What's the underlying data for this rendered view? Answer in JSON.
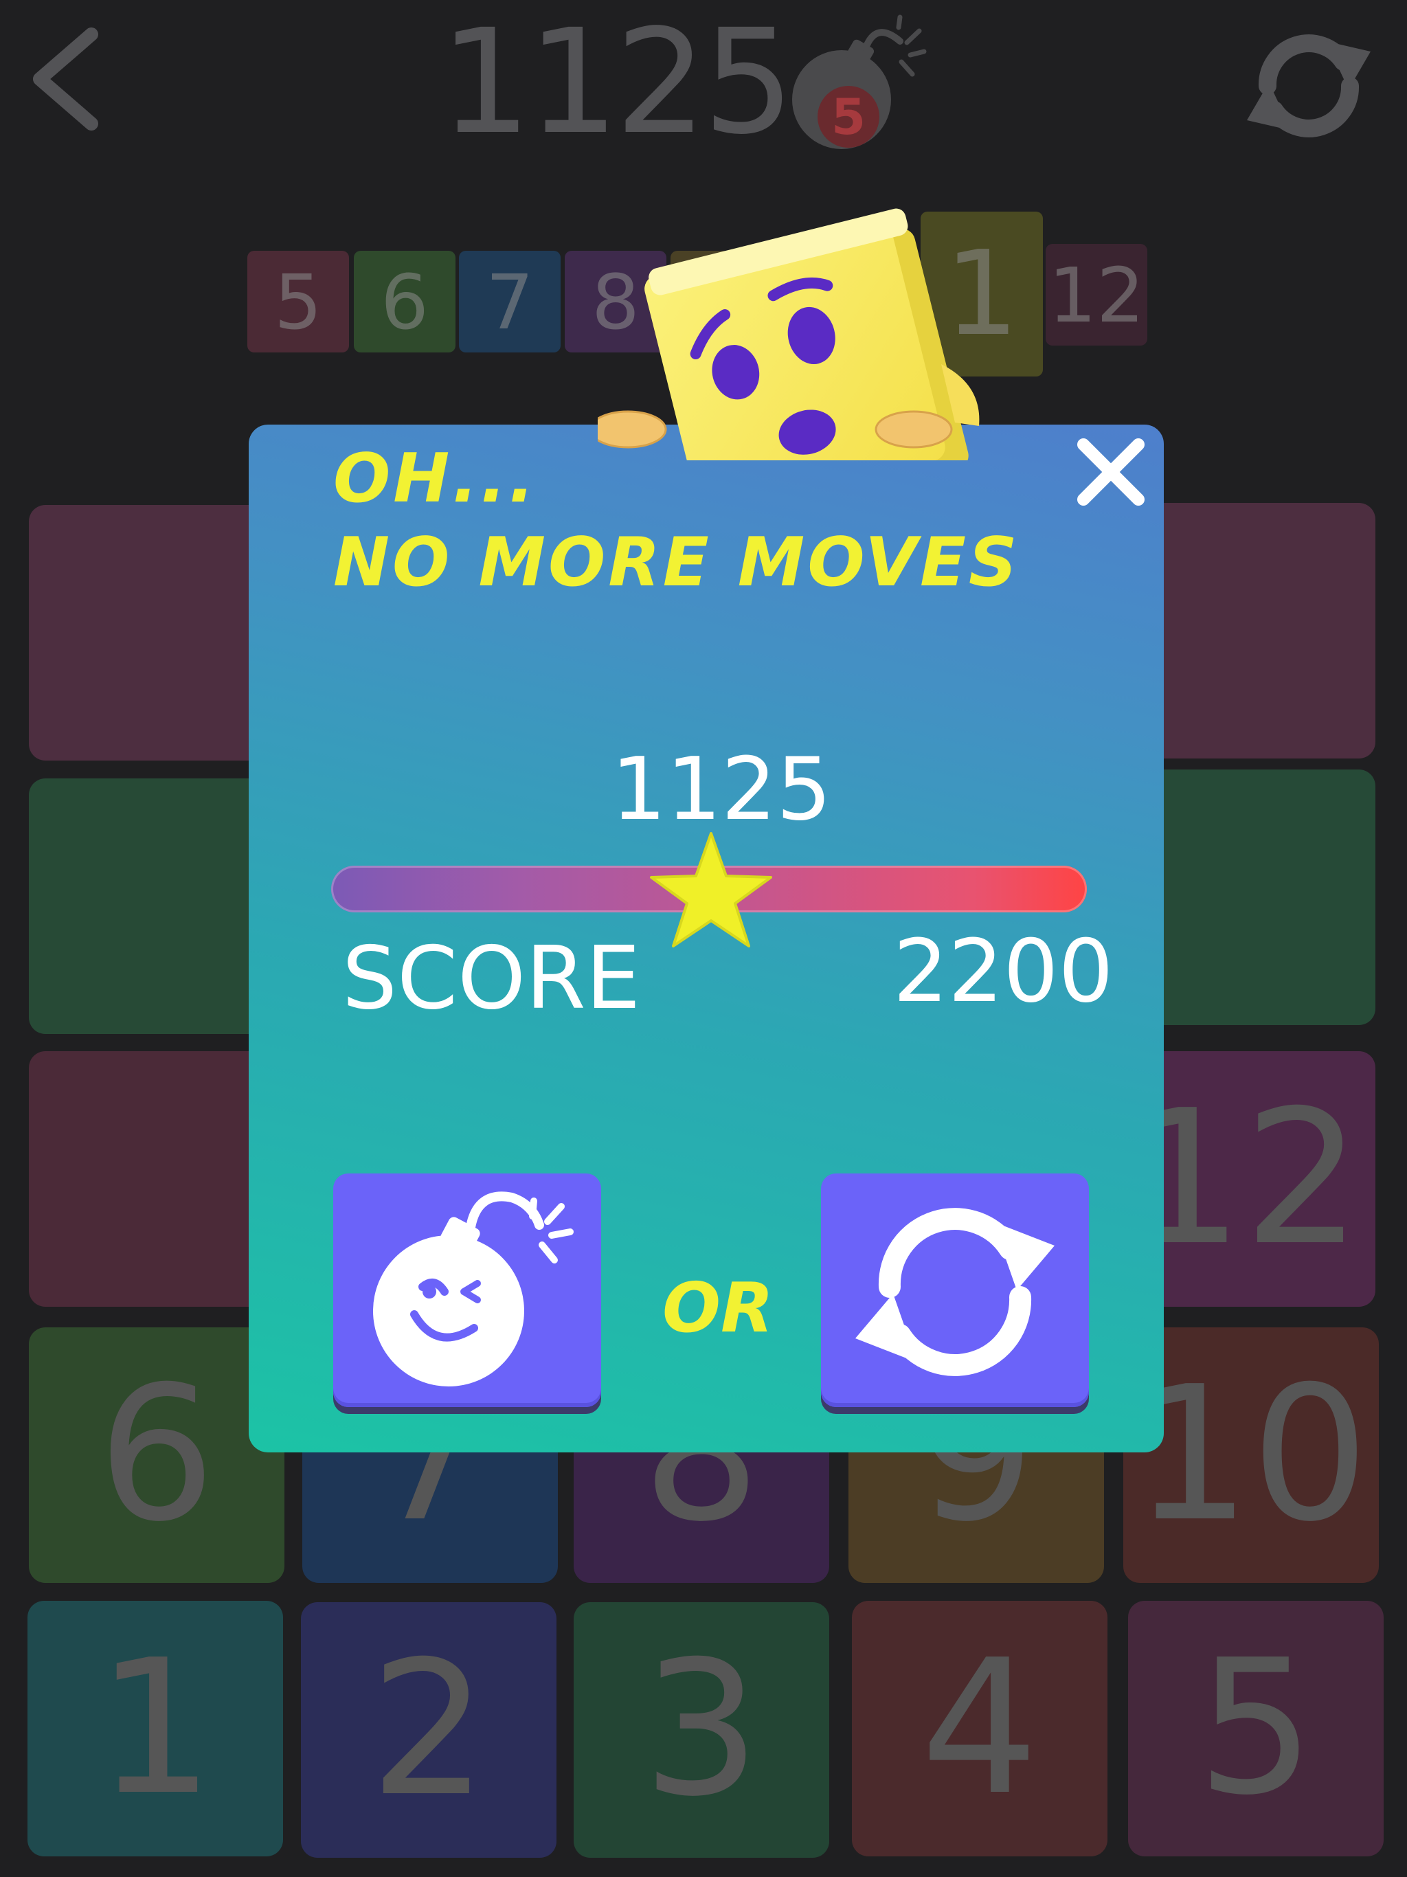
{
  "header": {
    "score": "1125",
    "bomb_count": "5",
    "back_icon": "chevron-left-icon",
    "refresh_icon": "refresh-icon",
    "bomb_icon": "bomb-icon"
  },
  "target_strip": [
    {
      "label": "5",
      "color": "#4b2a35"
    },
    {
      "label": "6",
      "color": "#2f4a2c"
    },
    {
      "label": "7",
      "color": "#1f3a55"
    },
    {
      "label": "8",
      "color": "#3e2a4c"
    },
    {
      "label": "",
      "color": "#4a4125"
    },
    {
      "label": "1",
      "color": "#4a4a22"
    },
    {
      "label": "12",
      "color": "#3a2430"
    }
  ],
  "board": [
    {
      "label": "",
      "color": "#4d2e40"
    },
    {
      "label": "",
      "color": "#4d2e40"
    },
    {
      "label": "",
      "color": "#274a36"
    },
    {
      "label": "",
      "color": "#264a37"
    },
    {
      "label": "",
      "color": "#4b2a38"
    },
    {
      "label": "12",
      "color": "#4d2848"
    },
    {
      "label": "6",
      "color": "#2f4a2c"
    },
    {
      "label": "7",
      "color": "#1e3656"
    },
    {
      "label": "8",
      "color": "#3a2449"
    },
    {
      "label": "9",
      "color": "#4c3d25"
    },
    {
      "label": "10",
      "color": "#4b2a28"
    },
    {
      "label": "1",
      "color": "#1f4a4e"
    },
    {
      "label": "2",
      "color": "#2b2d58"
    },
    {
      "label": "3",
      "color": "#234534"
    },
    {
      "label": "4",
      "color": "#4b2a2c"
    },
    {
      "label": "5",
      "color": "#45283c"
    }
  ],
  "dialog": {
    "title_line1": "OH...",
    "title_line2": "NO MORE MOVES",
    "score": "1125",
    "score_label": "SCORE",
    "target_score": "2200",
    "progress_fraction": 0.51,
    "or_label": "OR",
    "close_icon": "close-icon",
    "bomb_button_icon": "bomb-icon",
    "restart_button_icon": "refresh-icon",
    "accent_color": "#f2f233",
    "button_color": "#6b63f9"
  }
}
